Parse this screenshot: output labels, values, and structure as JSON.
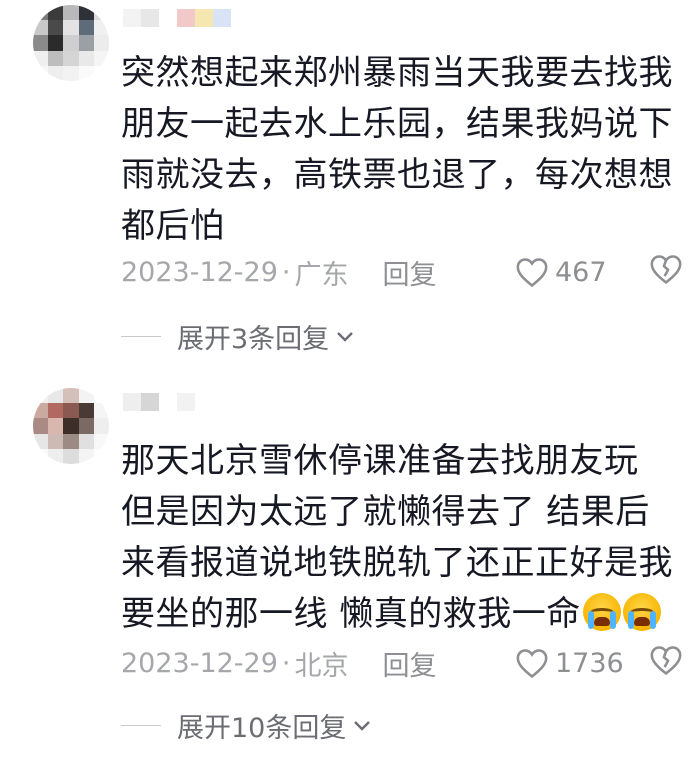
{
  "comments": [
    {
      "content": "突然想起来郑州暴雨当天我要去找我朋友一起去水上乐园，结果我妈说下雨就没去，高铁票也退了，每次想想都后怕",
      "date": "2023-12-29",
      "location": "广东",
      "reply_label": "回复",
      "likes": "467",
      "expand_label": "展开3条回复",
      "avatar_colors": [
        "#7a7a7a",
        "#3b3b3b",
        "#b9b9b9",
        "#2e3238",
        "#d9d9d9",
        "#c8c8c8",
        "#4a4a4a",
        "#e3e3e3",
        "#5e6b78",
        "#f0f0f0",
        "#8a8a8a",
        "#2b2b2b",
        "#cfcfcf",
        "#9aa0a6",
        "#ececec",
        "#efefef",
        "#bdbdbd",
        "#d5d5d5",
        "#e9e9e9",
        "#f5f5f5",
        "#f7f7f7",
        "#eeeeee",
        "#f2f2f2",
        "#fafafa",
        "#ffffff"
      ],
      "name_colors": [
        "#f3f3f3",
        "#e7e7e7",
        "#ffffff",
        "#f1c9c9",
        "#f6e6b0",
        "#d8e4f5"
      ]
    },
    {
      "content": "那天北京雪休停课准备去找朋友玩 但是因为太远了就懒得去了 结果后来看报道说地铁脱轨了还正正好是我要坐的那一线 懒真的救我一命",
      "date": "2023-12-29",
      "location": "北京",
      "reply_label": "回复",
      "likes": "1736",
      "expand_label": "展开10条回复",
      "avatar_colors": [
        "#f0f0f0",
        "#e8e8e8",
        "#d4c0b8",
        "#f3f3f3",
        "#ffffff",
        "#c9a9a0",
        "#b06a62",
        "#8a5a52",
        "#4a3a36",
        "#f5f5f5",
        "#a98a84",
        "#d9b6ae",
        "#3e2e2a",
        "#7b6a64",
        "#eeeeee",
        "#e6e6e6",
        "#cdbab4",
        "#9c8a84",
        "#e0e0e0",
        "#f8f8f8",
        "#f9f9f9",
        "#eeeeee",
        "#dddddd",
        "#f4f4f4",
        "#ffffff"
      ],
      "name_colors": [
        "#eeeeee",
        "#d6d6d6",
        "#ffffff",
        "#f2f2f2"
      ]
    }
  ],
  "icons": {
    "heart": "heart-outline-icon",
    "dislike": "broken-heart-icon",
    "chevron": "chevron-down-icon",
    "emoji": "crying-face-emoji"
  }
}
